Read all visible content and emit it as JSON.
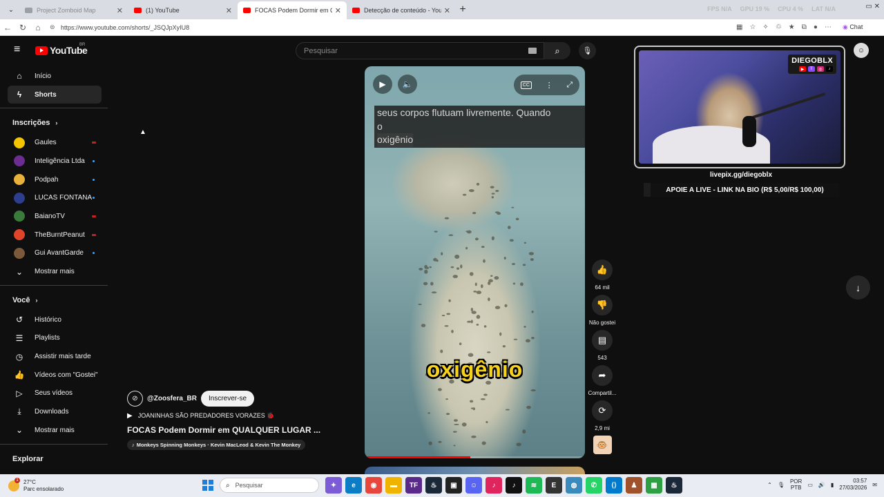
{
  "browser": {
    "tabs": [
      {
        "title": "Project Zomboid Map",
        "active": false
      },
      {
        "title": "(1) YouTube",
        "active": false
      },
      {
        "title": "FOCAS Podem Dormir em QUALQ",
        "active": true
      },
      {
        "title": "Detecção de conteúdo - YouTube",
        "active": false
      }
    ],
    "perf": {
      "fps": "FPS N/A",
      "gpu": "GPU 19 %",
      "cpu": "CPU 4 %",
      "lat": "LAT N/A"
    },
    "url": "https://www.youtube.com/shorts/_JSQJpXyIU8",
    "chat_label": "Chat"
  },
  "youtube": {
    "logo_text": "YouTube",
    "country": "BR",
    "search_placeholder": "Pesquisar",
    "sidebar": {
      "main": [
        {
          "label": "Início",
          "icon": "home-icon"
        },
        {
          "label": "Shorts",
          "icon": "shorts-icon",
          "active": true
        }
      ],
      "subs_header": "Inscrições",
      "subscriptions": [
        {
          "label": "Gaules",
          "color": "#f5c400",
          "status": "live"
        },
        {
          "label": "Inteligência Ltda",
          "color": "#6b2d8f",
          "status": "new"
        },
        {
          "label": "Podpah",
          "color": "#e8b23a",
          "status": "new"
        },
        {
          "label": "LUCAS FONTANA",
          "color": "#2d3e8f",
          "status": "new"
        },
        {
          "label": "BaianoTV",
          "color": "#3a7a3a",
          "status": "live"
        },
        {
          "label": "TheBurntPeanut",
          "color": "#e0452b",
          "status": "live"
        },
        {
          "label": "Gui AvantGarde",
          "color": "#7a5a3a",
          "status": "new"
        }
      ],
      "subs_more": "Mostrar mais",
      "you_header": "Você",
      "you_items": [
        {
          "label": "Histórico",
          "icon": "history-icon"
        },
        {
          "label": "Playlists",
          "icon": "playlists-icon"
        },
        {
          "label": "Assistir mais tarde",
          "icon": "clock-icon"
        },
        {
          "label": "Vídeos com \"Gostei\"",
          "icon": "like-icon"
        },
        {
          "label": "Seus vídeos",
          "icon": "video-icon"
        },
        {
          "label": "Downloads",
          "icon": "download-icon"
        }
      ],
      "you_more": "Mostrar mais",
      "explore_header": "Explorar"
    },
    "short": {
      "caption_lines": [
        "seus corpos flutuam livremente. Quando",
        "o",
        "oxigênio"
      ],
      "burned_subtitle": "oxigênio",
      "progress": 0.48,
      "channel": "@Zoosfera_BR",
      "subscribe": "Inscrever-se",
      "playlist": "JOANINHAS SÃO PREDADORES VORAZES 🐞",
      "title": "FOCAS Podem Dormir em QUALQUER LUGAR ...",
      "music": "Monkeys Spinning Monkeys · Kevin MacLeod & Kevin The Monkey",
      "actions": {
        "likes": "64 mil",
        "dislike": "Não gostei",
        "comments": "543",
        "share": "Compartil...",
        "remix": "2,9 mi"
      }
    }
  },
  "overlay": {
    "streamer": "DIEGOBLX",
    "livepix": "livepix.gg/diegoblx",
    "banner": "APOIE A LIVE - LINK NA BIO (R$ 5,00/R$ 100,00)"
  },
  "taskbar": {
    "temp": "27°C",
    "weather": "Parc ensolarado",
    "weather_badge": "1",
    "search": "Pesquisar",
    "lang1": "POR",
    "lang2": "PTB",
    "time": "03:57",
    "date": "27/03/2026"
  }
}
